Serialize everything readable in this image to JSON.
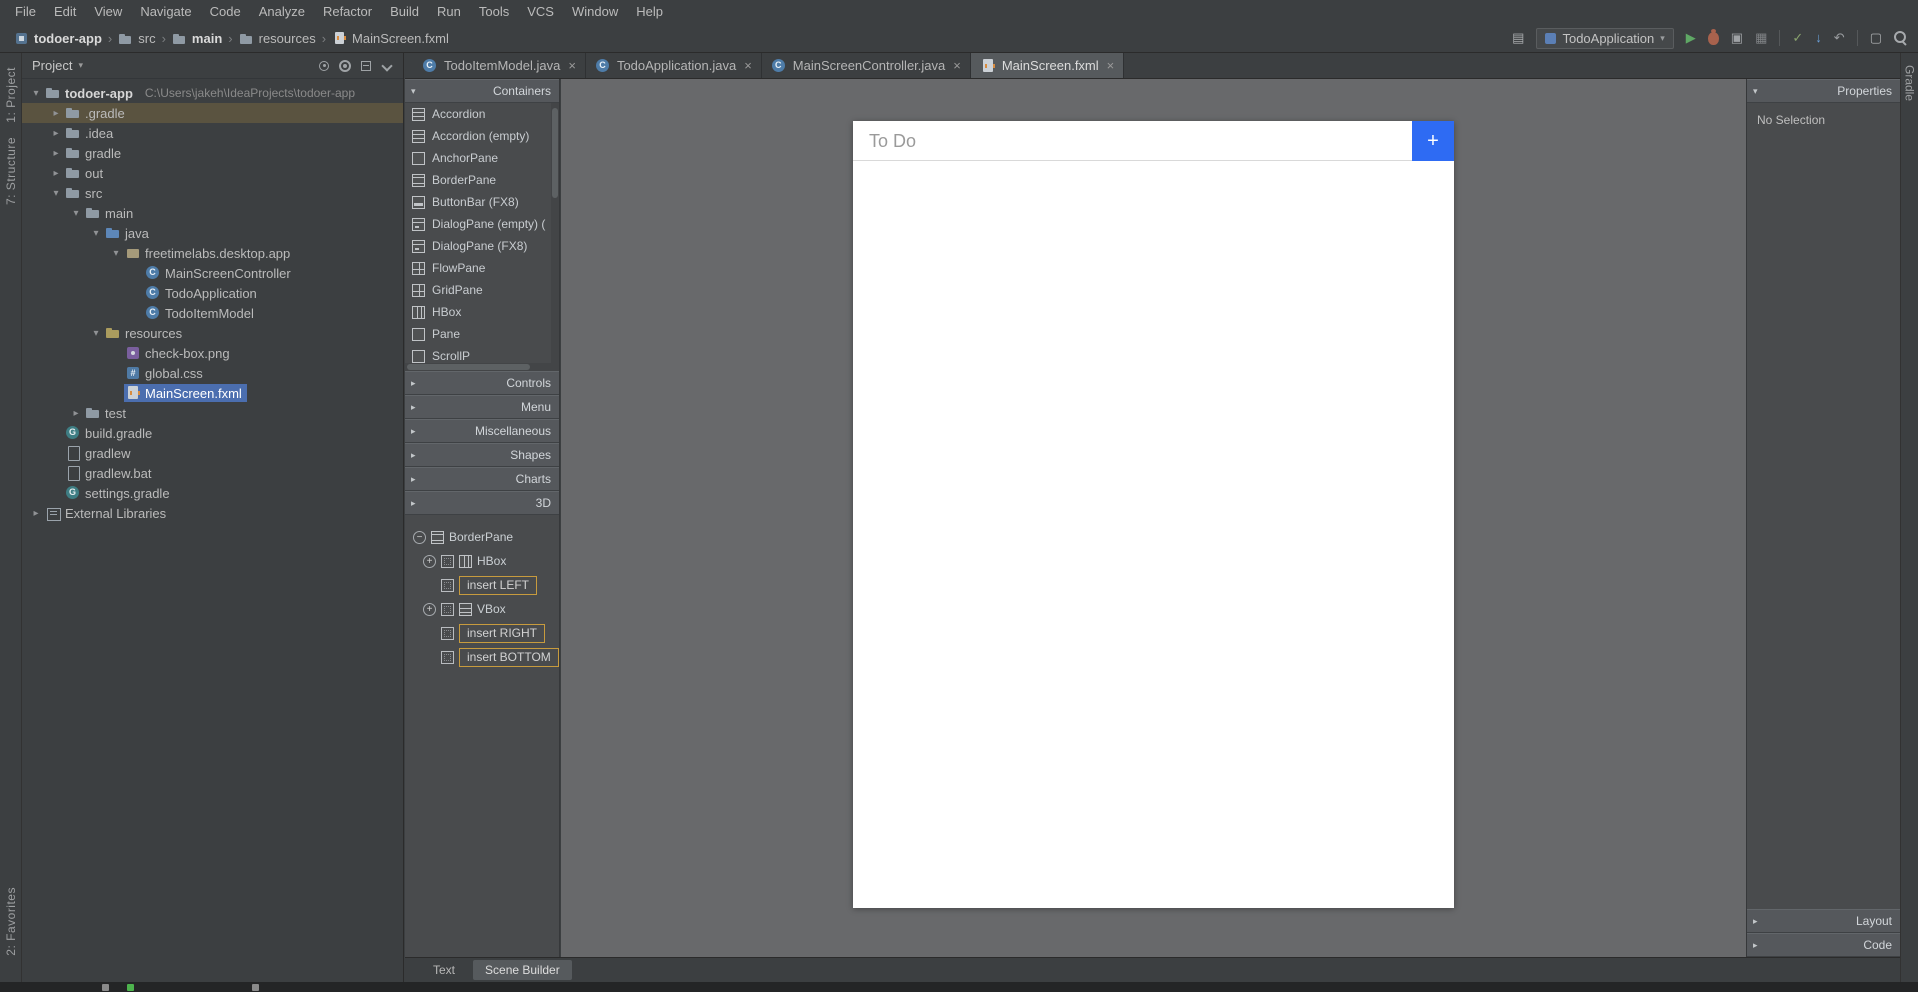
{
  "colors": {
    "accent_blue": "#2e6bf3",
    "selection_blue": "#4b6eaf",
    "insert_border": "#c79b3e",
    "run_green": "#5fa865"
  },
  "menu": {
    "items": [
      "File",
      "Edit",
      "View",
      "Navigate",
      "Code",
      "Analyze",
      "Refactor",
      "Build",
      "Run",
      "Tools",
      "VCS",
      "Window",
      "Help"
    ]
  },
  "navbar": {
    "crumbs": [
      {
        "label": "todoer-app",
        "icon": "project-icon",
        "bold": true
      },
      {
        "label": "src",
        "icon": "folder-icon",
        "bold": false
      },
      {
        "label": "main",
        "icon": "folder-icon",
        "bold": true
      },
      {
        "label": "resources",
        "icon": "folder-icon",
        "bold": false
      },
      {
        "label": "MainScreen.fxml",
        "icon": "fxml-file-icon",
        "bold": false
      }
    ],
    "actions": [
      {
        "name": "layout-icon",
        "glyph": "▤"
      },
      {
        "name": "run-config-select",
        "combo": true,
        "label": "TodoApplication"
      },
      {
        "name": "run-icon",
        "glyph": "▶",
        "color": "#5fa865"
      },
      {
        "name": "debug-icon",
        "bug": true
      },
      {
        "name": "coverage-icon",
        "glyph": "▣",
        "color": "#9fa2a5"
      },
      {
        "name": "profiler-icon",
        "glyph": "▦",
        "color": "#808386"
      },
      {
        "name": "toolbar-divider-1",
        "divider": true
      },
      {
        "name": "vcs-check-icon",
        "glyph": "✓",
        "color": "#89a36d"
      },
      {
        "name": "vcs-update-icon",
        "glyph": "↓",
        "color": "#6a9fd8"
      },
      {
        "name": "vcs-rollback-icon",
        "glyph": "↶",
        "color": "#9a9da0"
      },
      {
        "name": "toolbar-divider-2",
        "divider": true
      },
      {
        "name": "window-icon",
        "glyph": "▢"
      },
      {
        "name": "search-icon",
        "search": true
      }
    ]
  },
  "stripes": {
    "left_top": [
      "1: Project",
      "7: Structure"
    ],
    "left_bottom": [
      "2: Favorites"
    ],
    "right_top": [
      "Gradle"
    ]
  },
  "project_panel": {
    "title": "Project",
    "tree": [
      {
        "label": "todoer-app",
        "path": "C:\\Users\\jakeh\\IdeaProjects\\todoer-app",
        "level": 0,
        "icon": "folder",
        "arrow": "expanded",
        "bold": true
      },
      {
        "label": ".gradle",
        "level": 1,
        "icon": "folder",
        "arrow": "collapsed",
        "highlighted": true
      },
      {
        "label": ".idea",
        "level": 1,
        "icon": "folder",
        "arrow": "collapsed"
      },
      {
        "label": "gradle",
        "level": 1,
        "icon": "folder",
        "arrow": "collapsed"
      },
      {
        "label": "out",
        "level": 1,
        "icon": "folder",
        "arrow": "collapsed"
      },
      {
        "label": "src",
        "level": 1,
        "icon": "folder",
        "arrow": "expanded"
      },
      {
        "label": "main",
        "level": 2,
        "icon": "folder",
        "arrow": "expanded"
      },
      {
        "label": "java",
        "level": 3,
        "icon": "folder-src",
        "arrow": "expanded"
      },
      {
        "label": "freetimelabs.desktop.app",
        "level": 4,
        "icon": "package",
        "arrow": "expanded"
      },
      {
        "label": "MainScreenController",
        "level": 5,
        "icon": "class"
      },
      {
        "label": "TodoApplication",
        "level": 5,
        "icon": "class"
      },
      {
        "label": "TodoItemModel",
        "level": 5,
        "icon": "class"
      },
      {
        "label": "resources",
        "level": 3,
        "icon": "folder-res",
        "arrow": "expanded"
      },
      {
        "label": "check-box.png",
        "level": 4,
        "icon": "image"
      },
      {
        "label": "global.css",
        "level": 4,
        "icon": "css"
      },
      {
        "label": "MainScreen.fxml",
        "level": 4,
        "icon": "fxml",
        "selected": true
      },
      {
        "label": "test",
        "level": 2,
        "icon": "folder",
        "arrow": "collapsed"
      },
      {
        "label": "build.gradle",
        "level": 1,
        "icon": "gradle"
      },
      {
        "label": "gradlew",
        "level": 1,
        "icon": "file"
      },
      {
        "label": "gradlew.bat",
        "level": 1,
        "icon": "file"
      },
      {
        "label": "settings.gradle",
        "level": 1,
        "icon": "gradle"
      },
      {
        "label": "External Libraries",
        "level": 0,
        "icon": "library",
        "arrow": "collapsed"
      }
    ]
  },
  "editor": {
    "tabs": [
      {
        "label": "TodoItemModel.java",
        "icon": "class",
        "active": false
      },
      {
        "label": "TodoApplication.java",
        "icon": "class",
        "active": false
      },
      {
        "label": "MainScreenController.java",
        "icon": "class",
        "active": false
      },
      {
        "label": "MainScreen.fxml",
        "icon": "fxml",
        "active": true
      }
    ],
    "view_tabs": [
      {
        "label": "Text",
        "active": false
      },
      {
        "label": "Scene Builder",
        "active": true
      }
    ]
  },
  "scene_builder": {
    "library": {
      "sections": [
        {
          "label": "Containers",
          "expanded": true
        },
        {
          "label": "Controls",
          "expanded": false
        },
        {
          "label": "Menu",
          "expanded": false
        },
        {
          "label": "Miscellaneous",
          "expanded": false
        },
        {
          "label": "Shapes",
          "expanded": false
        },
        {
          "label": "Charts",
          "expanded": false
        },
        {
          "label": "3D",
          "expanded": false
        }
      ],
      "containers_items": [
        {
          "label": "Accordion",
          "icon": "accordion"
        },
        {
          "label": "Accordion  (empty)",
          "icon": "accordion"
        },
        {
          "label": "AnchorPane",
          "icon": "pane"
        },
        {
          "label": "BorderPane",
          "icon": "borderpane"
        },
        {
          "label": "ButtonBar  (FX8)",
          "icon": "buttonbar"
        },
        {
          "label": "DialogPane (empty)  (",
          "icon": "dialogpane"
        },
        {
          "label": "DialogPane  (FX8)",
          "icon": "dialogpane"
        },
        {
          "label": "FlowPane",
          "icon": "grid"
        },
        {
          "label": "GridPane",
          "icon": "grid"
        },
        {
          "label": "HBox",
          "icon": "hbox"
        },
        {
          "label": "Pane",
          "icon": "pane"
        },
        {
          "label": "ScrollP",
          "icon": "pane"
        }
      ]
    },
    "hierarchy": [
      {
        "label": "BorderPane",
        "toggle": "minus",
        "icon": "borderpane",
        "indent": 0
      },
      {
        "label": "HBox",
        "toggle": "plus",
        "slot": true,
        "icon": "hbox",
        "indent": 1
      },
      {
        "label": "insert LEFT",
        "slot": true,
        "insert": true,
        "indent": 1
      },
      {
        "label": "VBox",
        "toggle": "plus",
        "slot": true,
        "icon": "vbox",
        "indent": 1
      },
      {
        "label": "insert RIGHT",
        "slot": true,
        "insert": true,
        "indent": 1
      },
      {
        "label": "insert BOTTOM",
        "slot": true,
        "insert": true,
        "indent": 1
      }
    ]
  },
  "design_canvas": {
    "todo_field_text": "To Do",
    "add_button_label": "+"
  },
  "properties_panel": {
    "title": "Properties",
    "empty_message": "No Selection",
    "bottom_sections": [
      {
        "label": "Layout"
      },
      {
        "label": "Code"
      }
    ]
  },
  "statusbar": {
    "icons": [
      {
        "name": "toolwindow-icon",
        "color": "#8a8a8a"
      },
      {
        "name": "run-status-icon",
        "color": "#4db34d"
      },
      {
        "name": "event-log-icon",
        "color": "#8a8a8a",
        "offset": 100
      }
    ]
  }
}
